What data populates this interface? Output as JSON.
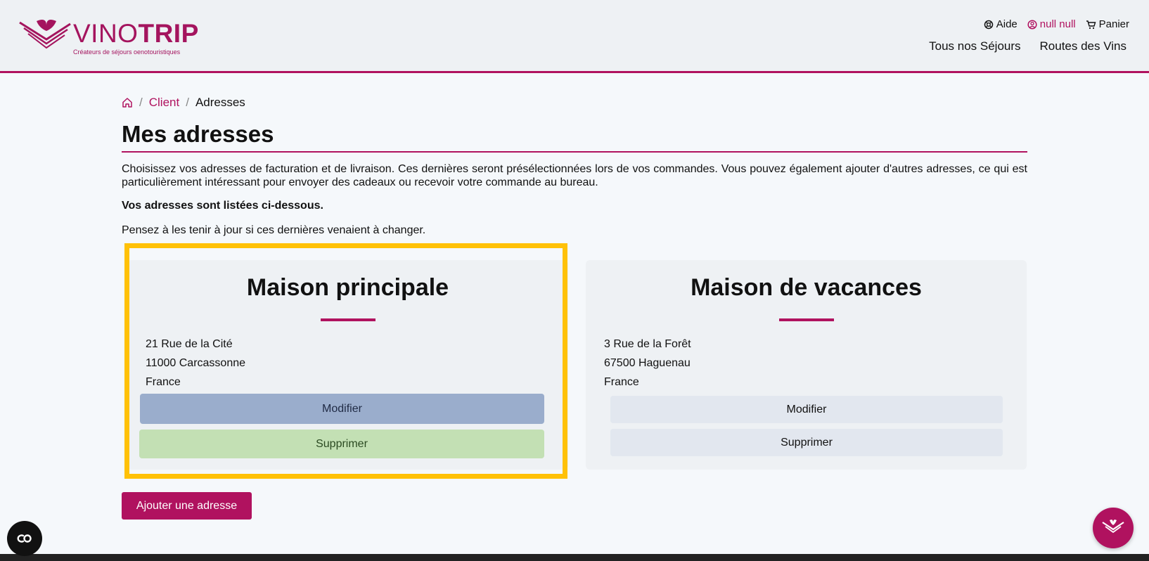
{
  "header": {
    "logo": {
      "wordmark_light": "VINO",
      "wordmark_bold": "TRIP",
      "tagline": "Créateurs de séjours oenotouristiques"
    },
    "top_links": {
      "help": "Aide",
      "user": "null null",
      "cart": "Panier"
    },
    "nav": {
      "stays": "Tous nos Séjours",
      "wine_routes": "Routes des Vins"
    }
  },
  "breadcrumb": {
    "client": "Client",
    "current": "Adresses",
    "separator": "/"
  },
  "page": {
    "title": "Mes adresses",
    "intro": "Choisissez vos adresses de facturation et de livraison. Ces dernières seront présélectionnées lors de vos commandes. Vous pouvez également ajouter d'autres adresses, ce qui est particulièrement intéressant pour envoyer des cadeaux ou recevoir votre commande au bureau.",
    "intro_bold": "Vos adresses sont listées ci-dessous.",
    "intro_note": "Pensez à les tenir à jour si ces dernières venaient à changer."
  },
  "addresses": [
    {
      "title": "Maison principale",
      "street": "21 Rue de la Cité",
      "city": "11000 Carcassonne",
      "country": "France",
      "modify_label": "Modifier",
      "delete_label": "Supprimer"
    },
    {
      "title": "Maison de vacances",
      "street": "3 Rue de la Forêt",
      "city": "67500 Haguenau",
      "country": "France",
      "modify_label": "Modifier",
      "delete_label": "Supprimer"
    }
  ],
  "actions": {
    "add_address": "Ajouter une adresse"
  },
  "colors": {
    "brand": "#b0125f",
    "highlight": "#ffc107",
    "modify_highlight": "#9aadcc",
    "delete_highlight": "#c3e0b4"
  },
  "icons": {
    "home": "home-icon",
    "help": "help-lifebuoy-icon",
    "user": "user-icon",
    "cart": "cart-icon",
    "accessibility": "accessibility-icon",
    "chat": "chat-icon"
  }
}
